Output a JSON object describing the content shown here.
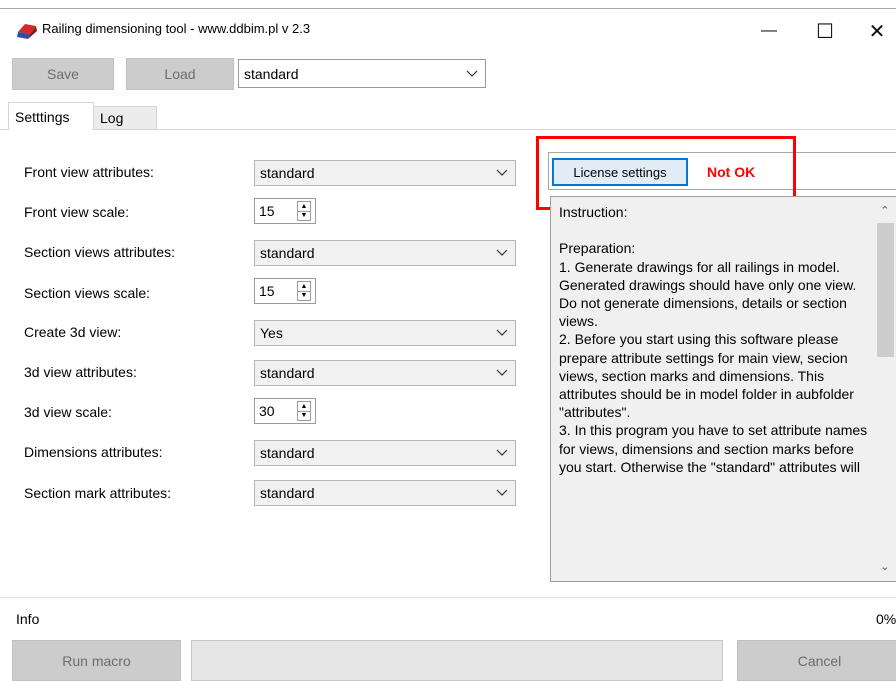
{
  "window": {
    "title": "Railing dimensioning tool - www.ddbim.pl v 2.3",
    "minimize_glyph": "—",
    "maximize_glyph": "☐",
    "close_glyph": "✕"
  },
  "toolbar": {
    "save_label": "Save",
    "load_label": "Load",
    "preset_value": "standard"
  },
  "tabs": [
    {
      "label": "Setttings",
      "active": true
    },
    {
      "label": "Log",
      "active": false
    }
  ],
  "settings": {
    "front_view_attributes": {
      "label": "Front view attributes:",
      "value": "standard"
    },
    "front_view_scale": {
      "label": "Front view scale:",
      "value": "15"
    },
    "section_views_attributes": {
      "label": "Section views attributes:",
      "value": "standard"
    },
    "section_views_scale": {
      "label": "Section views scale:",
      "value": "15"
    },
    "create_3d_view": {
      "label": "Create 3d view:",
      "value": "Yes"
    },
    "view_3d_attributes": {
      "label": "3d view attributes:",
      "value": "standard"
    },
    "view_3d_scale": {
      "label": "3d view scale:",
      "value": "30"
    },
    "dimensions_attributes": {
      "label": "Dimensions attributes:",
      "value": "standard"
    },
    "section_mark_attributes": {
      "label": "Section mark attributes:",
      "value": "standard"
    }
  },
  "license": {
    "button_label": "License settings",
    "status": "Not OK",
    "status_color": "#ff0000",
    "highlight_color": "#ff0000"
  },
  "instructions": {
    "text": "Instruction:\n\nPreparation:\n1. Generate drawings for all railings in model. Generated drawings should have only one view. Do not generate dimensions, details or section views.\n2. Before you start using this software please prepare attribute settings for main view, secion views, section marks and dimensions. This attributes should be in model folder in aubfolder \"attributes\".\n3. In this program you have to set attribute names for views, dimensions and section marks before you start. Otherwise the \"standard\" attributes will"
  },
  "footer": {
    "info_label": "Info",
    "progress_text": "0%",
    "progress_value": 0,
    "run_label": "Run macro",
    "cancel_label": "Cancel"
  }
}
